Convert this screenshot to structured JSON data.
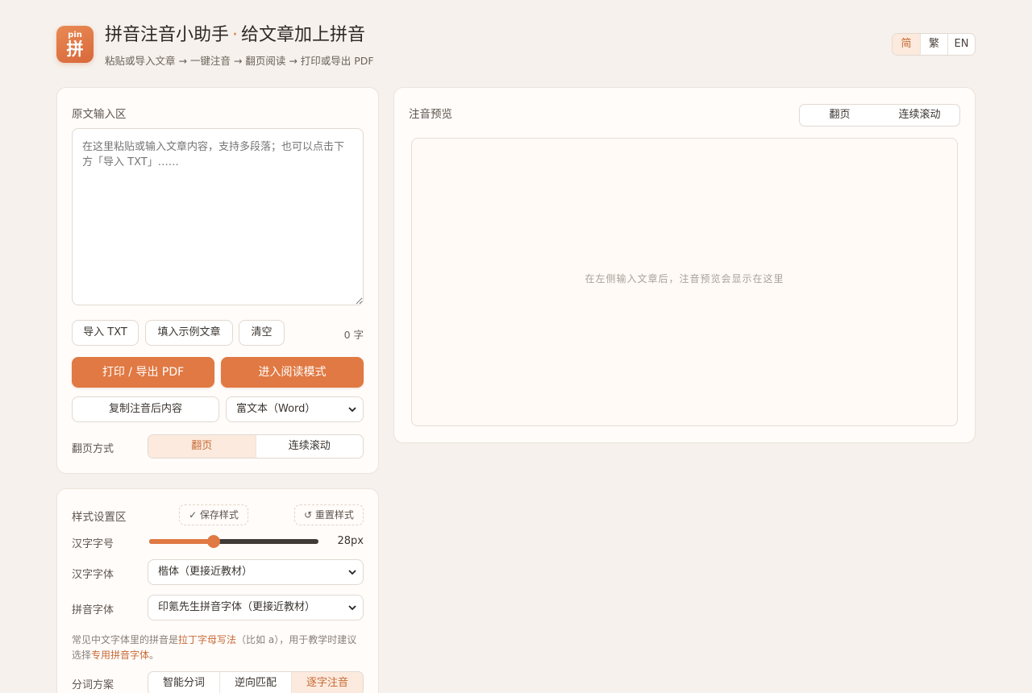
{
  "header": {
    "logo_top": "pin",
    "logo_char": "拼",
    "title_main": "拼音注音小助手",
    "title_sep": "·",
    "title_sub": "给文章加上拼音",
    "subtitle": "粘贴或导入文章 → 一键注音 → 翻页阅读 → 打印或导出 PDF",
    "languages": [
      "简",
      "繁",
      "EN"
    ],
    "active_language": "简"
  },
  "input_panel": {
    "label": "原文输入区",
    "textarea_placeholder": "在这里粘贴或输入文章内容，支持多段落；也可以点击下方「导入 TXT」……",
    "textarea_value": "",
    "import_button": "导入 TXT",
    "sample_button": "填入示例文章",
    "clear_button": "清空",
    "char_count": "0 字",
    "print_button": "打印 / 导出 PDF",
    "reading_button": "进入阅读模式",
    "copy_button": "复制注音后内容",
    "copy_format": "富文本（Word）",
    "paging_label": "翻页方式",
    "paging_options": [
      "翻页",
      "连续滚动"
    ],
    "paging_selected": "翻页"
  },
  "preview_panel": {
    "label": "注音预览",
    "mode_options": [
      "翻页",
      "连续滚动"
    ],
    "empty_text": "在左侧输入文章后，注音预览会显示在这里"
  },
  "style_panel": {
    "label": "样式设置区",
    "save_button": "✓ 保存样式",
    "reset_button": "↺ 重置样式",
    "font_size_label": "汉字字号",
    "font_size_value": "28px",
    "font_size_fraction": 0.38,
    "hanzi_font_label": "汉字字体",
    "hanzi_font_value": "楷体（更接近教材）",
    "pinyin_font_label": "拼音字体",
    "pinyin_font_value": "印氪先生拼音字体（更接近教材）",
    "hint_part1": "常见中文字体里的拼音是",
    "hint_hl1": "拉丁字母写法",
    "hint_part2": "（比如 a），用于教学时建议选择",
    "hint_hl2": "专用拼音字体",
    "hint_part3": "。",
    "segment_label": "分词方案",
    "segment_options": [
      "智能分词",
      "逆向匹配",
      "逐字注音"
    ],
    "segment_selected": "逐字注音"
  },
  "colors": {
    "accent": "#e07943",
    "accent_soft": "#fbeadd",
    "background": "#f6f1ec"
  }
}
